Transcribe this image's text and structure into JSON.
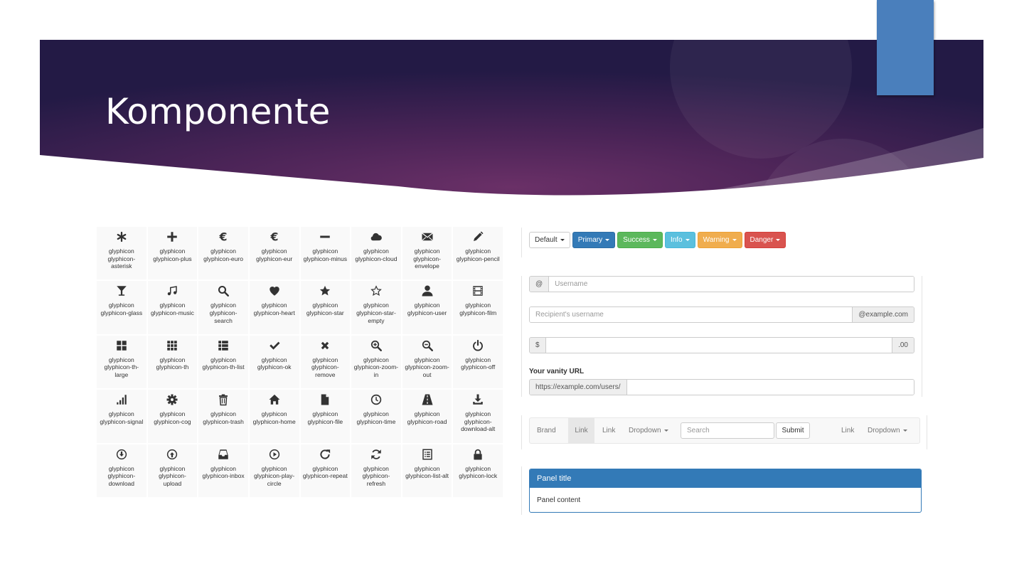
{
  "slide": {
    "title": "Komponente"
  },
  "colors": {
    "banner_dark": "#251b47",
    "banner_mid": "#6a3067",
    "accent_tab": "#4a7fbc",
    "primary": "#337ab7",
    "success": "#5cb85c",
    "info": "#5bc0de",
    "warning": "#f0ad4e",
    "danger": "#d9534f"
  },
  "glyphicons": [
    {
      "icon": "asterisk-icon",
      "label": "glyphicon glyphicon-asterisk"
    },
    {
      "icon": "plus-icon",
      "label": "glyphicon glyphicon-plus"
    },
    {
      "icon": "euro-icon",
      "label": "glyphicon glyphicon-euro"
    },
    {
      "icon": "eur-icon",
      "label": "glyphicon glyphicon-eur"
    },
    {
      "icon": "minus-icon",
      "label": "glyphicon glyphicon-minus"
    },
    {
      "icon": "cloud-icon",
      "label": "glyphicon glyphicon-cloud"
    },
    {
      "icon": "envelope-icon",
      "label": "glyphicon glyphicon-envelope"
    },
    {
      "icon": "pencil-icon",
      "label": "glyphicon glyphicon-pencil"
    },
    {
      "icon": "glass-icon",
      "label": "glyphicon glyphicon-glass"
    },
    {
      "icon": "music-icon",
      "label": "glyphicon glyphicon-music"
    },
    {
      "icon": "search-icon",
      "label": "glyphicon glyphicon-search"
    },
    {
      "icon": "heart-icon",
      "label": "glyphicon glyphicon-heart"
    },
    {
      "icon": "star-icon",
      "label": "glyphicon glyphicon-star"
    },
    {
      "icon": "star-empty-icon",
      "label": "glyphicon glyphicon-star-empty"
    },
    {
      "icon": "user-icon",
      "label": "glyphicon glyphicon-user"
    },
    {
      "icon": "film-icon",
      "label": "glyphicon glyphicon-film"
    },
    {
      "icon": "th-large-icon",
      "label": "glyphicon glyphicon-th-large"
    },
    {
      "icon": "th-icon",
      "label": "glyphicon glyphicon-th"
    },
    {
      "icon": "th-list-icon",
      "label": "glyphicon glyphicon-th-list"
    },
    {
      "icon": "ok-icon",
      "label": "glyphicon glyphicon-ok"
    },
    {
      "icon": "remove-icon",
      "label": "glyphicon glyphicon-remove"
    },
    {
      "icon": "zoom-in-icon",
      "label": "glyphicon glyphicon-zoom-in"
    },
    {
      "icon": "zoom-out-icon",
      "label": "glyphicon glyphicon-zoom-out"
    },
    {
      "icon": "off-icon",
      "label": "glyphicon glyphicon-off"
    },
    {
      "icon": "signal-icon",
      "label": "glyphicon glyphicon-signal"
    },
    {
      "icon": "cog-icon",
      "label": "glyphicon glyphicon-cog"
    },
    {
      "icon": "trash-icon",
      "label": "glyphicon glyphicon-trash"
    },
    {
      "icon": "home-icon",
      "label": "glyphicon glyphicon-home"
    },
    {
      "icon": "file-icon",
      "label": "glyphicon glyphicon-file"
    },
    {
      "icon": "time-icon",
      "label": "glyphicon glyphicon-time"
    },
    {
      "icon": "road-icon",
      "label": "glyphicon glyphicon-road"
    },
    {
      "icon": "download-alt-icon",
      "label": "glyphicon glyphicon-download-alt"
    },
    {
      "icon": "download-icon",
      "label": "glyphicon glyphicon-download"
    },
    {
      "icon": "upload-icon",
      "label": "glyphicon glyphicon-upload"
    },
    {
      "icon": "inbox-icon",
      "label": "glyphicon glyphicon-inbox"
    },
    {
      "icon": "play-circle-icon",
      "label": "glyphicon glyphicon-play-circle"
    },
    {
      "icon": "repeat-icon",
      "label": "glyphicon glyphicon-repeat"
    },
    {
      "icon": "refresh-icon",
      "label": "glyphicon glyphicon-refresh"
    },
    {
      "icon": "list-alt-icon",
      "label": "glyphicon glyphicon-list-alt"
    },
    {
      "icon": "lock-icon",
      "label": "glyphicon glyphicon-lock"
    }
  ],
  "buttons": {
    "default": "Default",
    "primary": "Primary",
    "success": "Success",
    "info": "Info",
    "warning": "Warning",
    "danger": "Danger"
  },
  "input_groups": {
    "username": {
      "addon": "@",
      "placeholder": "Username"
    },
    "recipient": {
      "placeholder": "Recipient's username",
      "addon": "@example.com"
    },
    "amount": {
      "addon_left": "$",
      "addon_right": ".00",
      "value": ""
    },
    "vanity": {
      "label": "Your vanity URL",
      "addon": "https://example.com/users/",
      "value": ""
    }
  },
  "navbar": {
    "brand": "Brand",
    "link_active": "Link",
    "link_2": "Link",
    "dropdown_1": "Dropdown",
    "search_placeholder": "Search",
    "submit": "Submit",
    "link_3": "Link",
    "dropdown_2": "Dropdown"
  },
  "panel": {
    "title": "Panel title",
    "content": "Panel content"
  }
}
